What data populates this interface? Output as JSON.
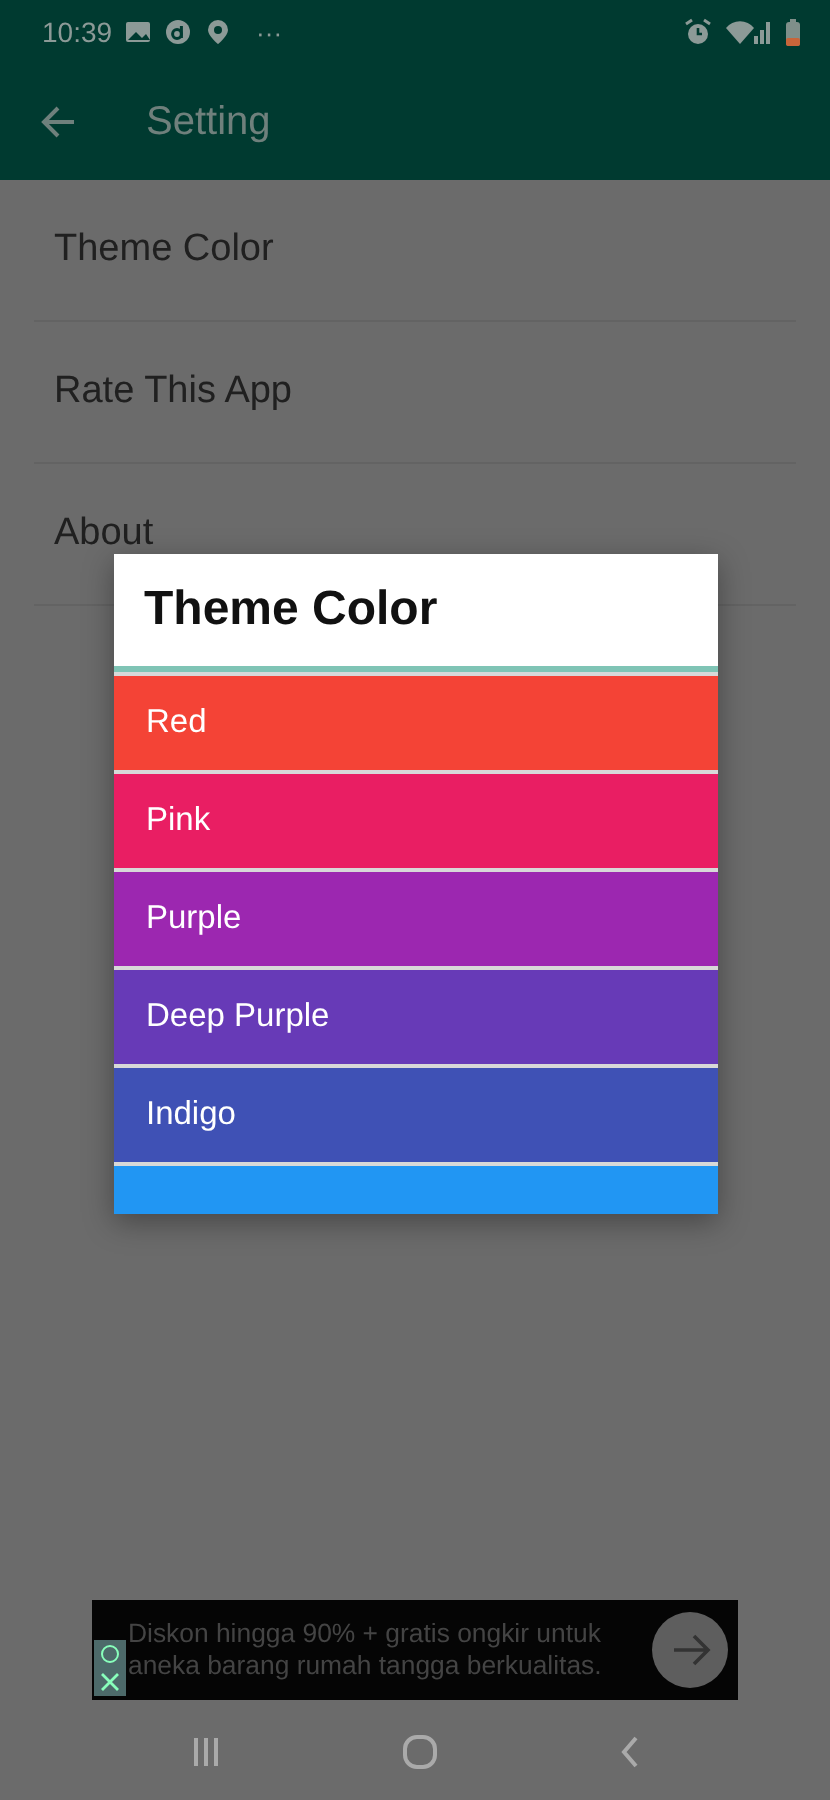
{
  "status_bar": {
    "time": "10:39",
    "more": "···"
  },
  "app_bar": {
    "title": "Setting"
  },
  "settings": [
    {
      "label": "Theme Color"
    },
    {
      "label": "Rate This App"
    },
    {
      "label": "About"
    }
  ],
  "dialog": {
    "title": "Theme Color",
    "colors": [
      {
        "label": "Red",
        "color": "#f44336"
      },
      {
        "label": "Pink",
        "color": "#e91e63"
      },
      {
        "label": "Purple",
        "color": "#9c27b0"
      },
      {
        "label": "Deep Purple",
        "color": "#673ab7"
      },
      {
        "label": "Indigo",
        "color": "#3f51b5"
      },
      {
        "color": "#2196f3"
      }
    ]
  },
  "ad": {
    "text": "Diskon hingga 90% + gratis ongkir untuk aneka barang rumah tangga berkualitas."
  }
}
